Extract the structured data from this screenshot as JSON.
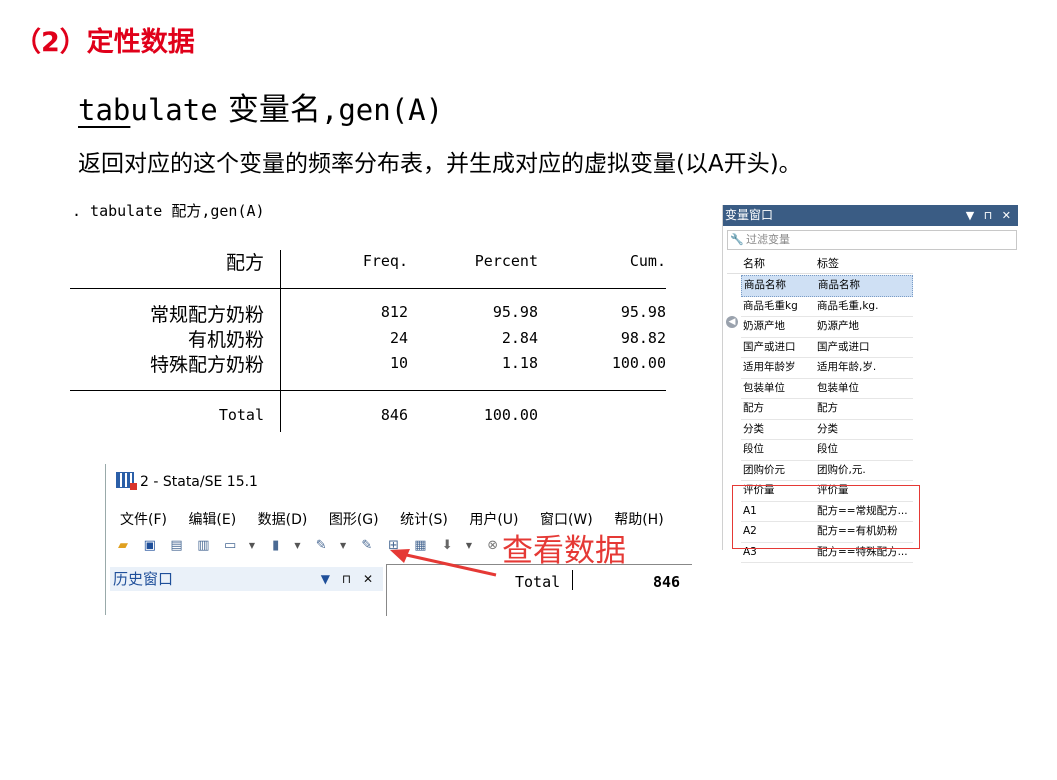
{
  "section_title": "（2）定性数据",
  "syntax": {
    "cmd_underlined": "tab",
    "cmd_rest": "ulate",
    "var_placeholder": "变量名",
    "option": ",gen(A)"
  },
  "description": "返回对应的这个变量的频率分布表，并生成对应的虚拟变量(以A开头)。",
  "stata_output": {
    "command": ". tabulate 配方,gen(A)",
    "headers": [
      "配方",
      "Freq.",
      "Percent",
      "Cum."
    ],
    "rows": [
      {
        "label": "常规配方奶粉",
        "freq": "812",
        "percent": "95.98",
        "cum": "95.98"
      },
      {
        "label": "有机奶粉",
        "freq": "24",
        "percent": "2.84",
        "cum": "98.82"
      },
      {
        "label": "特殊配方奶粉",
        "freq": "10",
        "percent": "1.18",
        "cum": "100.00"
      }
    ],
    "total": {
      "label": "Total",
      "freq": "846",
      "percent": "100.00"
    }
  },
  "variable_window": {
    "title": "变量窗口",
    "title_buttons": "▼ ⊓ ✕",
    "filter_placeholder": "过滤变量",
    "col_name": "名称",
    "col_label": "标签",
    "variables": [
      {
        "name": "商品名称",
        "label": "商品名称",
        "selected": true
      },
      {
        "name": "商品毛重kg",
        "label": "商品毛重,kg."
      },
      {
        "name": "奶源产地",
        "label": "奶源产地"
      },
      {
        "name": "国产或进口",
        "label": "国产或进口"
      },
      {
        "name": "适用年龄岁",
        "label": "适用年龄,岁."
      },
      {
        "name": "包装单位",
        "label": "包装单位"
      },
      {
        "name": "配方",
        "label": "配方"
      },
      {
        "name": "分类",
        "label": "分类"
      },
      {
        "name": "段位",
        "label": "段位"
      },
      {
        "name": "团购价元",
        "label": "团购价,元."
      },
      {
        "name": "评价量",
        "label": "评价量"
      },
      {
        "name": "A1",
        "label": "配方==常规配方..."
      },
      {
        "name": "A2",
        "label": "配方==有机奶粉"
      },
      {
        "name": "A3",
        "label": "配方==特殊配方..."
      }
    ],
    "highlight_color": "#e53935",
    "titlebar_color": "#3a5c84"
  },
  "stata_window": {
    "title": "2 - Stata/SE 15.1",
    "menu": [
      "文件(F)",
      "编辑(E)",
      "数据(D)",
      "图形(G)",
      "统计(S)",
      "用户(U)",
      "窗口(W)",
      "帮助(H)"
    ],
    "history_title": "历史窗口",
    "output_total_label": "Total",
    "output_total_value": "846"
  },
  "annotation": "查看数据"
}
